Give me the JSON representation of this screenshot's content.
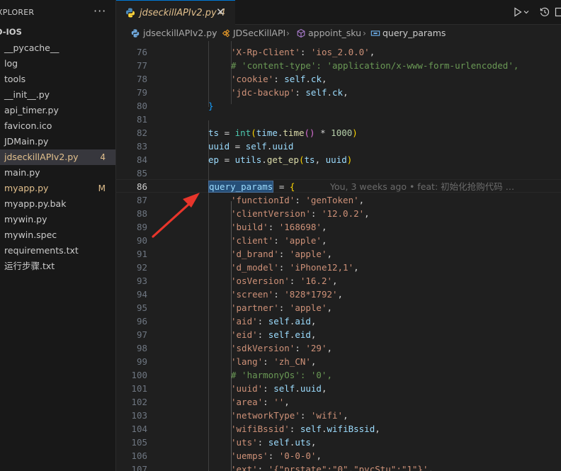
{
  "sidebar": {
    "title": "XPLORER",
    "more": "···",
    "folder": "D-IOS",
    "items": [
      {
        "label": "__pycache__",
        "badge": "",
        "status": "normal"
      },
      {
        "label": "log",
        "badge": "",
        "status": "normal"
      },
      {
        "label": "tools",
        "badge": "",
        "status": "normal"
      },
      {
        "label": "__init__.py",
        "badge": "",
        "status": "normal"
      },
      {
        "label": "api_timer.py",
        "badge": "",
        "status": "normal"
      },
      {
        "label": "favicon.ico",
        "badge": "",
        "status": "normal"
      },
      {
        "label": "JDMain.py",
        "badge": "",
        "status": "normal"
      },
      {
        "label": "jdseckillAPIv2.py",
        "badge": "4",
        "status": "error"
      },
      {
        "label": "main.py",
        "badge": "",
        "status": "normal"
      },
      {
        "label": "myapp.py",
        "badge": "M",
        "status": "modified"
      },
      {
        "label": "myapp.py.bak",
        "badge": "",
        "status": "normal"
      },
      {
        "label": "mywin.py",
        "badge": "",
        "status": "normal"
      },
      {
        "label": "mywin.spec",
        "badge": "",
        "status": "normal"
      },
      {
        "label": "requirements.txt",
        "badge": "",
        "status": "normal"
      },
      {
        "label": "运行步骤.txt",
        "badge": "",
        "status": "normal"
      }
    ]
  },
  "tab": {
    "label": "jdseckillAPIv2.py",
    "badge": "4",
    "close": "✕"
  },
  "breadcrumb": {
    "file": "jdseckillAPIv2.py",
    "class": "JDSecKillAPI",
    "method": "appoint_sku",
    "variable": "query_params"
  },
  "editor": {
    "blame": "You, 3 weeks ago • feat: 初始化抢购代码 …",
    "lines": [
      {
        "n": "76",
        "code": "'X-Rp-Client': 'ios_2.0.0',"
      },
      {
        "n": "77",
        "code": "# 'content-type': 'application/x-www-form-urlencoded',"
      },
      {
        "n": "78",
        "code": "'cookie': self.ck,"
      },
      {
        "n": "79",
        "code": "'jdc-backup': self.ck,"
      },
      {
        "n": "80",
        "code": "}"
      },
      {
        "n": "81",
        "code": ""
      },
      {
        "n": "82",
        "code": "ts = int(time.time() * 1000)"
      },
      {
        "n": "83",
        "code": "uuid = self.uuid"
      },
      {
        "n": "84",
        "code": "ep = utils.get_ep(ts, uuid)"
      },
      {
        "n": "85",
        "code": ""
      },
      {
        "n": "86",
        "code": "query_params = {"
      },
      {
        "n": "87",
        "code": "'functionId': 'genToken',"
      },
      {
        "n": "88",
        "code": "'clientVersion': '12.0.2',"
      },
      {
        "n": "89",
        "code": "'build': '168698',"
      },
      {
        "n": "90",
        "code": "'client': 'apple',"
      },
      {
        "n": "91",
        "code": "'d_brand': 'apple',"
      },
      {
        "n": "92",
        "code": "'d_model': 'iPhone12,1',"
      },
      {
        "n": "93",
        "code": "'osVersion': '16.2',"
      },
      {
        "n": "94",
        "code": "'screen': '828*1792',"
      },
      {
        "n": "95",
        "code": "'partner': 'apple',"
      },
      {
        "n": "96",
        "code": "'aid': self.aid,"
      },
      {
        "n": "97",
        "code": "'eid': self.eid,"
      },
      {
        "n": "98",
        "code": "'sdkVersion': '29',"
      },
      {
        "n": "99",
        "code": "'lang': 'zh_CN',"
      },
      {
        "n": "100",
        "code": "# 'harmonyOs': '0',"
      },
      {
        "n": "101",
        "code": "'uuid': self.uuid,"
      },
      {
        "n": "102",
        "code": "'area': '',"
      },
      {
        "n": "103",
        "code": "'networkType': 'wifi',"
      },
      {
        "n": "104",
        "code": "'wifiBssid': self.wifiBssid,"
      },
      {
        "n": "105",
        "code": "'uts': self.uts,"
      },
      {
        "n": "106",
        "code": "'uemps': '0-0-0',"
      },
      {
        "n": "107",
        "code": "'ext': '{\"prstate\":\"0\",\"pvcStu\":\"1\"}',"
      }
    ]
  },
  "colors": {
    "accent": "#0078d4",
    "annotation_arrow": "#e8352b",
    "string": "#ce9178",
    "variable": "#9cdcfe",
    "comment": "#6a9955"
  }
}
